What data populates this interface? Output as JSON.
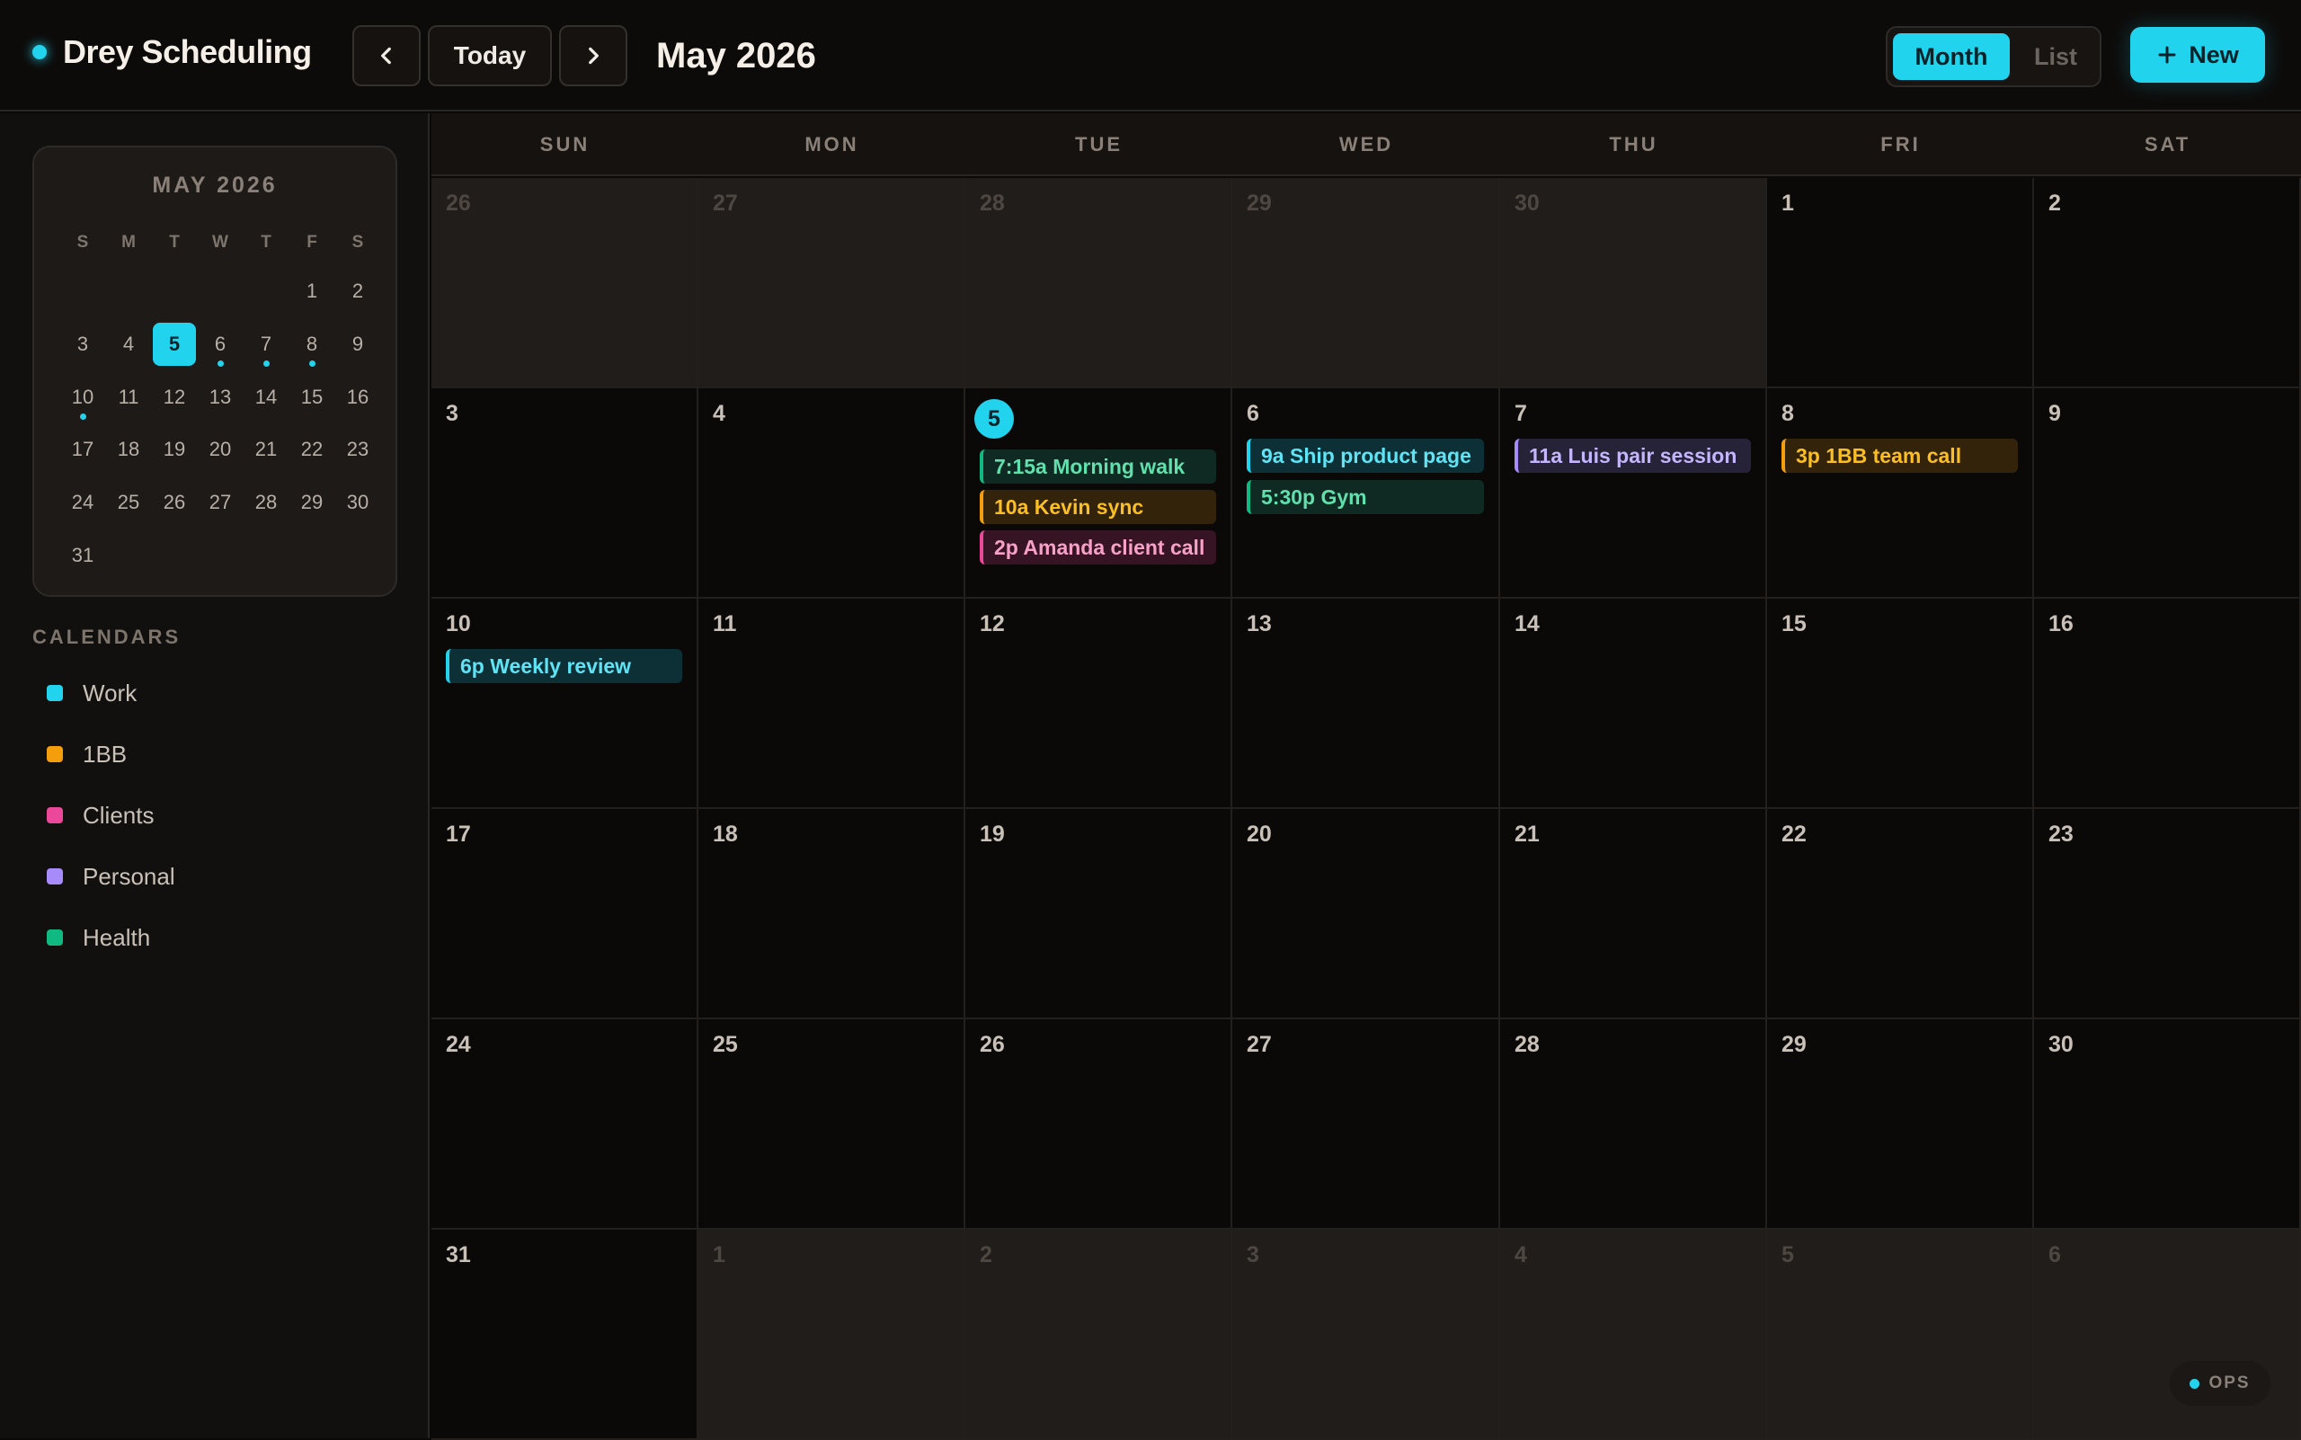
{
  "header": {
    "brand": "Drey Scheduling",
    "today_label": "Today",
    "month_title": "May 2026",
    "view_month": "Month",
    "view_list": "List",
    "new_label": "New"
  },
  "mini_calendar": {
    "title": "MAY 2026",
    "dow": [
      "S",
      "M",
      "T",
      "W",
      "T",
      "F",
      "S"
    ],
    "days": [
      "",
      "",
      "",
      "",
      "",
      "1",
      "2",
      "3",
      "4",
      "5",
      "6",
      "7",
      "8",
      "9",
      "10",
      "11",
      "12",
      "13",
      "14",
      "15",
      "16",
      "17",
      "18",
      "19",
      "20",
      "21",
      "22",
      "23",
      "24",
      "25",
      "26",
      "27",
      "28",
      "29",
      "30",
      "31"
    ],
    "today": "5",
    "event_days": [
      "6",
      "7",
      "8",
      "10"
    ]
  },
  "calendars": {
    "heading": "CALENDARS",
    "items": [
      {
        "label": "Work",
        "color": "#22d3ee"
      },
      {
        "label": "1BB",
        "color": "#f59e0b"
      },
      {
        "label": "Clients",
        "color": "#ec4899"
      },
      {
        "label": "Personal",
        "color": "#a78bfa"
      },
      {
        "label": "Health",
        "color": "#10b981"
      }
    ]
  },
  "grid": {
    "dow": [
      "SUN",
      "MON",
      "TUE",
      "WED",
      "THU",
      "FRI",
      "SAT"
    ],
    "weeks": [
      [
        {
          "d": "26",
          "o": true
        },
        {
          "d": "27",
          "o": true
        },
        {
          "d": "28",
          "o": true
        },
        {
          "d": "29",
          "o": true
        },
        {
          "d": "30",
          "o": true
        },
        {
          "d": "1"
        },
        {
          "d": "2"
        }
      ],
      [
        {
          "d": "3"
        },
        {
          "d": "4"
        },
        {
          "d": "5",
          "today": true
        },
        {
          "d": "6"
        },
        {
          "d": "7"
        },
        {
          "d": "8"
        },
        {
          "d": "9"
        }
      ],
      [
        {
          "d": "10"
        },
        {
          "d": "11"
        },
        {
          "d": "12"
        },
        {
          "d": "13"
        },
        {
          "d": "14"
        },
        {
          "d": "15"
        },
        {
          "d": "16"
        }
      ],
      [
        {
          "d": "17"
        },
        {
          "d": "18"
        },
        {
          "d": "19"
        },
        {
          "d": "20"
        },
        {
          "d": "21"
        },
        {
          "d": "22"
        },
        {
          "d": "23"
        }
      ],
      [
        {
          "d": "24"
        },
        {
          "d": "25"
        },
        {
          "d": "26"
        },
        {
          "d": "27"
        },
        {
          "d": "28"
        },
        {
          "d": "29"
        },
        {
          "d": "30"
        }
      ],
      [
        {
          "d": "31"
        },
        {
          "d": "1",
          "o": true
        },
        {
          "d": "2",
          "o": true
        },
        {
          "d": "3",
          "o": true
        },
        {
          "d": "4",
          "o": true
        },
        {
          "d": "5",
          "o": true
        },
        {
          "d": "6",
          "o": true
        }
      ]
    ]
  },
  "events": [
    {
      "week": 1,
      "day": 2,
      "label": "7:15a Morning walk",
      "cal": "health"
    },
    {
      "week": 1,
      "day": 2,
      "label": "10a Kevin sync",
      "cal": "1bb"
    },
    {
      "week": 1,
      "day": 2,
      "label": "2p Amanda client call",
      "cal": "clients"
    },
    {
      "week": 1,
      "day": 3,
      "label": "9a Ship product page",
      "cal": "work"
    },
    {
      "week": 1,
      "day": 3,
      "label": "5:30p Gym",
      "cal": "health"
    },
    {
      "week": 1,
      "day": 4,
      "label": "11a Luis pair session",
      "cal": "personal"
    },
    {
      "week": 1,
      "day": 5,
      "label": "3p 1BB team call",
      "cal": "1bb"
    },
    {
      "week": 2,
      "day": 0,
      "label": "6p Weekly review",
      "cal": "work"
    }
  ],
  "ops_badge": "OPS"
}
